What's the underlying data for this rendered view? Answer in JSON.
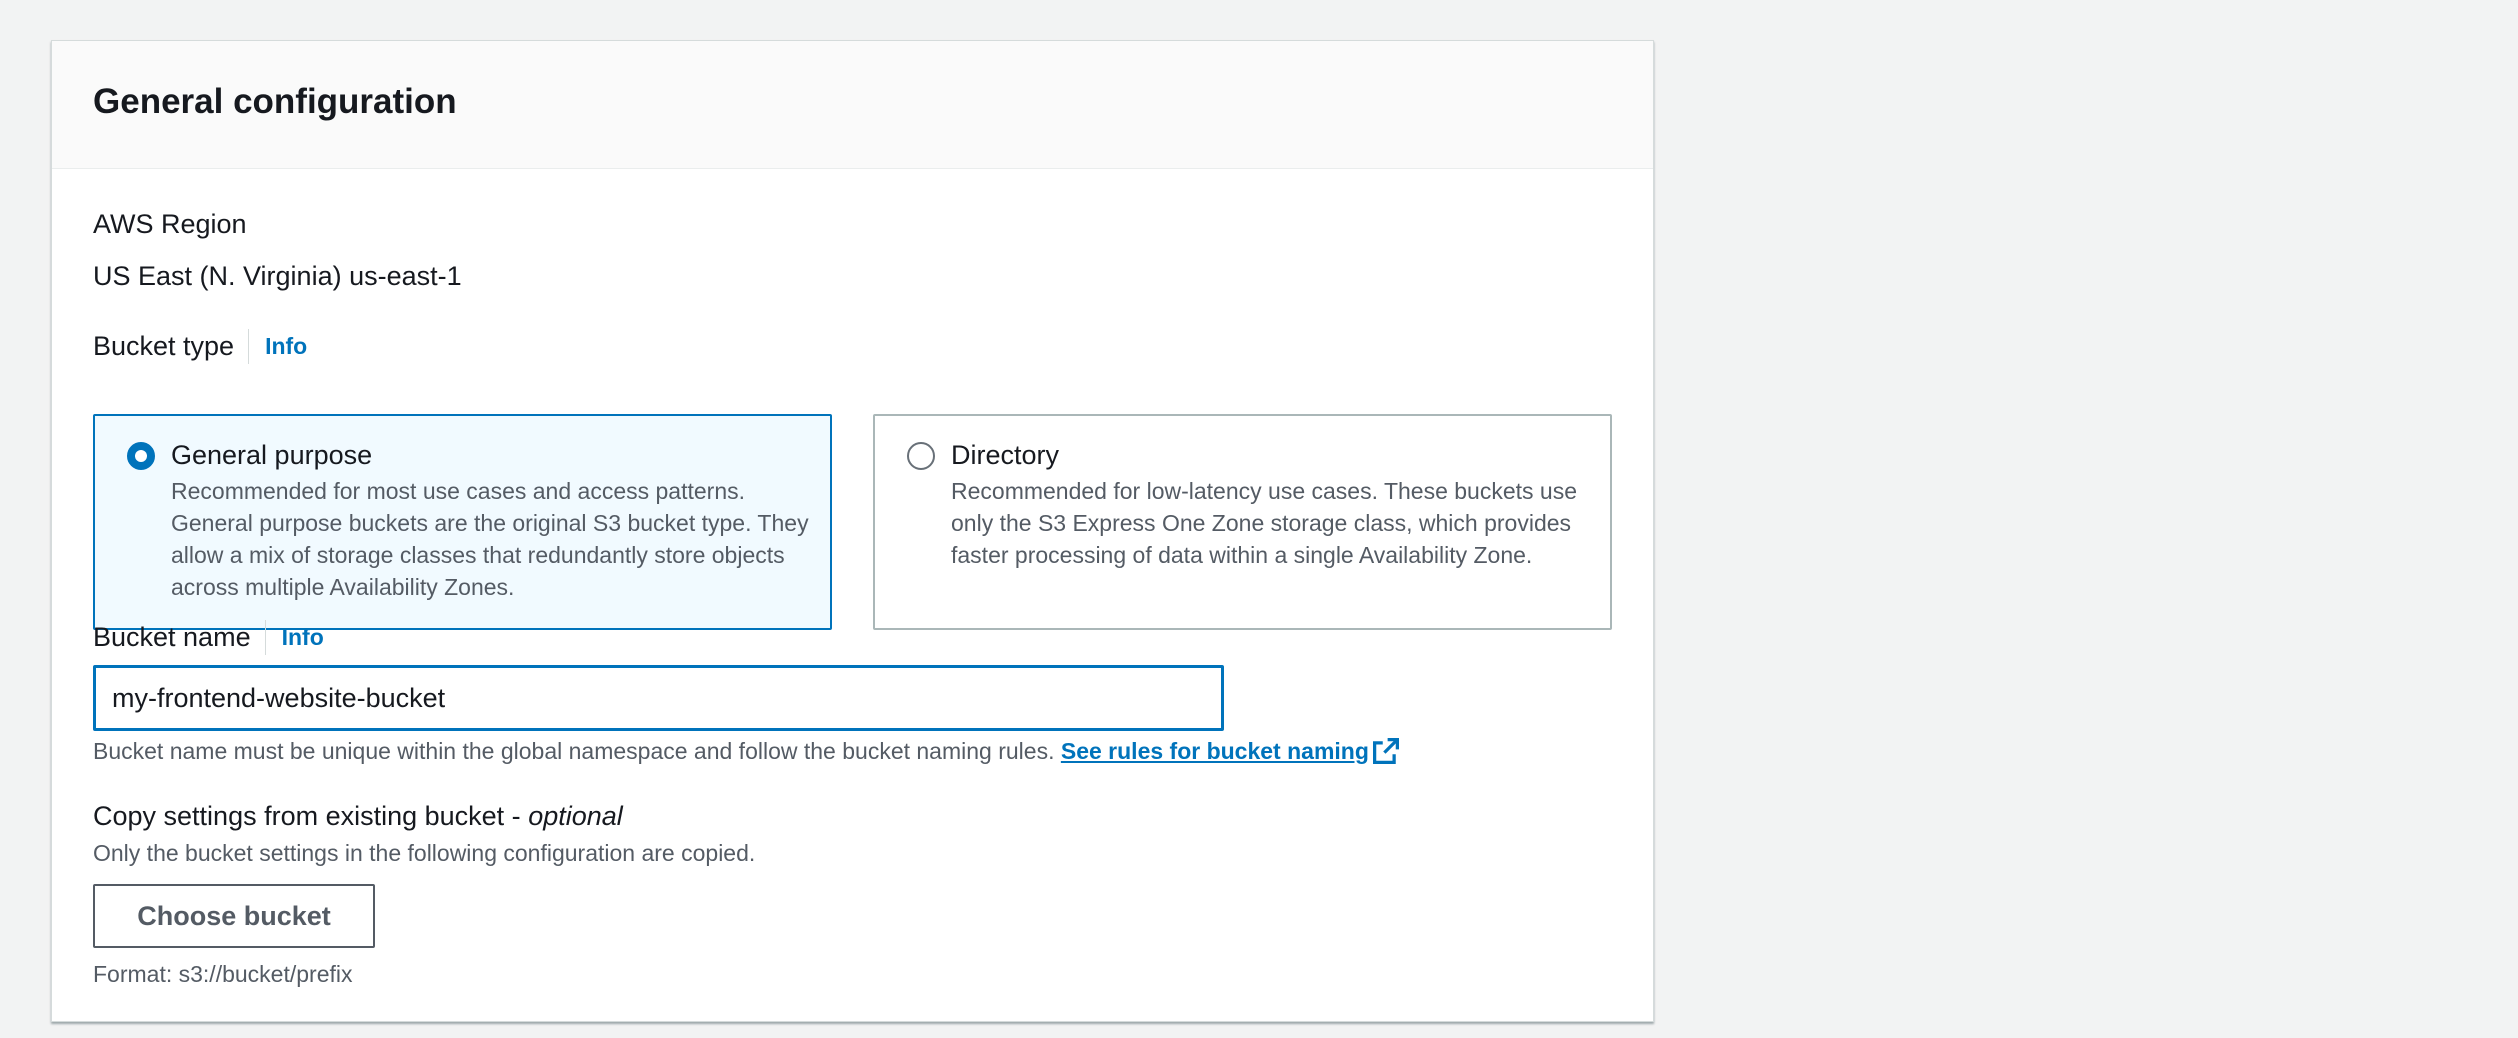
{
  "panel": {
    "title": "General configuration"
  },
  "region": {
    "label": "AWS Region",
    "value": "US East (N. Virginia) us-east-1"
  },
  "bucket_type": {
    "label": "Bucket type",
    "info": "Info",
    "options": [
      {
        "title": "General purpose",
        "description": "Recommended for most use cases and access patterns. General purpose buckets are the original S3 bucket type. They allow a mix of storage classes that redundantly store objects across multiple Availability Zones.",
        "selected": true
      },
      {
        "title": "Directory",
        "description": "Recommended for low-latency use cases. These buckets use only the S3 Express One Zone storage class, which provides faster processing of data within a single Availability Zone.",
        "selected": false
      }
    ]
  },
  "bucket_name": {
    "label": "Bucket name",
    "info": "Info",
    "value": "my-frontend-website-bucket",
    "hint": "Bucket name must be unique within the global namespace and follow the bucket naming rules.",
    "rules_link": "See rules for bucket naming"
  },
  "copy_settings": {
    "label": "Copy settings from existing bucket - ",
    "optional": "optional",
    "description": "Only the bucket settings in the following configuration are copied.",
    "button_label": "Choose bucket",
    "format_hint": "Format: s3://bucket/prefix"
  },
  "colors": {
    "accent": "#0073bb",
    "selected_tile_bg": "#f1faff",
    "page_bg": "#f2f3f3",
    "secondary_text": "#545b64"
  },
  "icons": {
    "external_link": "external-link-icon"
  }
}
